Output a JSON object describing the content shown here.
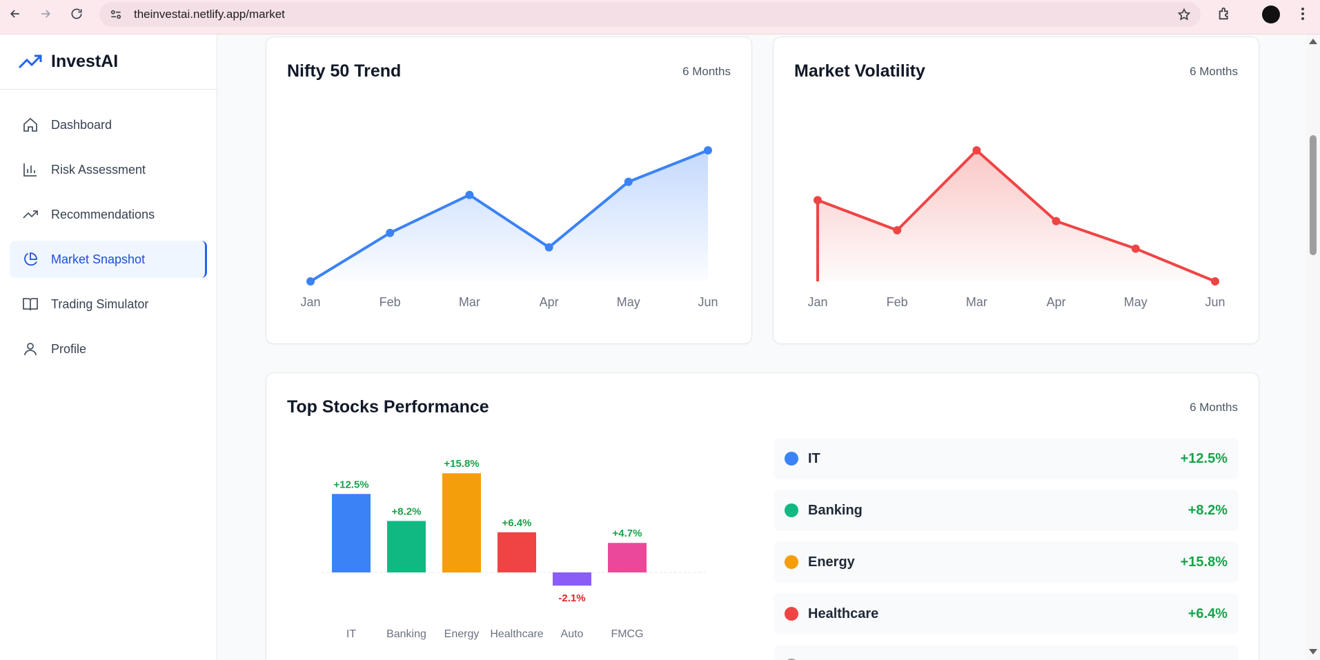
{
  "browser": {
    "url": "theinvestai.netlify.app/market",
    "icons": [
      "back-icon",
      "forward-icon",
      "reload-icon",
      "site-settings-icon",
      "bookmark-star-icon",
      "extensions-icon",
      "profile-avatar",
      "menu-kebab-icon"
    ]
  },
  "sidebar": {
    "brand": "InvestAI",
    "items": [
      {
        "label": "Dashboard",
        "icon": "home-icon",
        "active": false
      },
      {
        "label": "Risk Assessment",
        "icon": "bar-chart-icon",
        "active": false
      },
      {
        "label": "Recommendations",
        "icon": "trending-up-icon",
        "active": false
      },
      {
        "label": "Market Snapshot",
        "icon": "pie-chart-icon",
        "active": true
      },
      {
        "label": "Trading Simulator",
        "icon": "book-icon",
        "active": false
      },
      {
        "label": "Profile",
        "icon": "user-icon",
        "active": false
      }
    ]
  },
  "colors": {
    "accent": "#2563eb",
    "line_blue": "#3b82f6",
    "line_red": "#ef4444",
    "positive": "#16a34a",
    "negative": "#dc2626"
  },
  "cards": {
    "nifty": {
      "title": "Nifty 50 Trend",
      "period": "6 Months"
    },
    "volatility": {
      "title": "Market Volatility",
      "period": "6 Months"
    },
    "stocks": {
      "title": "Top Stocks Performance",
      "period": "6 Months"
    }
  },
  "chart_data": [
    {
      "type": "area",
      "title": "Nifty 50 Trend",
      "categories": [
        "Jan",
        "Feb",
        "Mar",
        "Apr",
        "May",
        "Jun"
      ],
      "values": [
        0,
        37,
        66,
        26,
        76,
        100
      ],
      "ylim": [
        0,
        100
      ],
      "color": "#3b82f6",
      "grid": false
    },
    {
      "type": "area",
      "title": "Market Volatility",
      "categories": [
        "Jan",
        "Feb",
        "Mar",
        "Apr",
        "May",
        "Jun"
      ],
      "values": [
        62,
        39,
        100,
        46,
        25,
        0
      ],
      "ylim": [
        0,
        100
      ],
      "color": "#ef4444",
      "grid": false
    },
    {
      "type": "bar",
      "title": "Top Stocks Performance",
      "categories": [
        "IT",
        "Banking",
        "Energy",
        "Healthcare",
        "Auto",
        "FMCG"
      ],
      "values": [
        12.5,
        8.2,
        15.8,
        6.4,
        -2.1,
        4.7
      ],
      "value_labels": [
        "+12.5%",
        "+8.2%",
        "+15.8%",
        "+6.4%",
        "-2.1%",
        "+4.7%"
      ],
      "colors": [
        "#3b82f6",
        "#10b981",
        "#f59e0b",
        "#ef4444",
        "#8b5cf6",
        "#ec4899"
      ],
      "ylim": [
        -4,
        11.2
      ]
    }
  ],
  "legend": [
    {
      "name": "IT",
      "value": "+12.5%",
      "color": "#3b82f6"
    },
    {
      "name": "Banking",
      "value": "+8.2%",
      "color": "#10b981"
    },
    {
      "name": "Energy",
      "value": "+15.8%",
      "color": "#f59e0b"
    },
    {
      "name": "Healthcare",
      "value": "+6.4%",
      "color": "#ef4444"
    }
  ]
}
